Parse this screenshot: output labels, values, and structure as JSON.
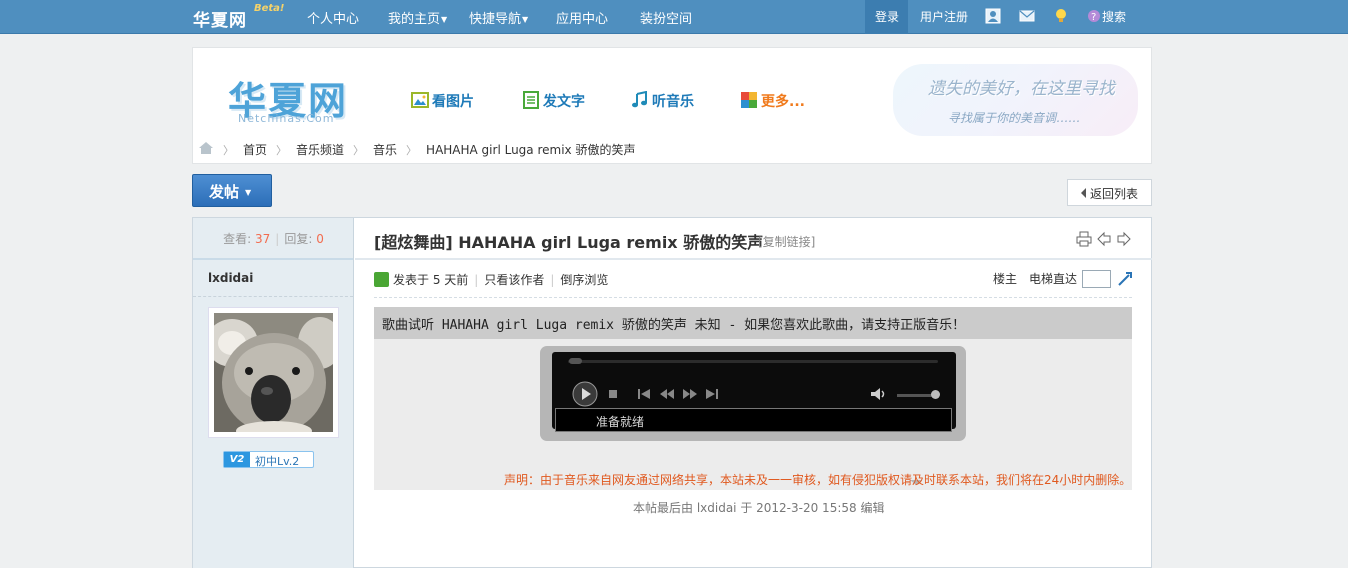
{
  "topbar": {
    "logo": "华夏网",
    "beta": "Beta!",
    "nav": [
      {
        "label": "个人中心",
        "caret": false
      },
      {
        "label": "我的主页",
        "caret": true
      },
      {
        "label": "快捷导航",
        "caret": true
      },
      {
        "label": "应用中心",
        "caret": false
      },
      {
        "label": "装扮空间",
        "caret": false
      }
    ],
    "login": "登录",
    "register": "用户注册",
    "search": "搜索",
    "icons": [
      "user-icon",
      "mail-icon",
      "bulb-icon",
      "search-icon"
    ]
  },
  "header": {
    "logo_text": "华夏网",
    "logo_sub": "Netchinas.Com",
    "quick_links": [
      {
        "label": "看图片",
        "icon": "image-icon"
      },
      {
        "label": "发文字",
        "icon": "document-icon"
      },
      {
        "label": "听音乐",
        "icon": "music-note-icon"
      },
      {
        "label": "更多...",
        "icon": "grid-icon"
      }
    ],
    "banner_line1": "遗失的美好，在这里寻找",
    "banner_line2": "寻找属于你的美音调……",
    "breadcrumb": [
      "首页",
      "音乐频道",
      "音乐",
      "HAHAHA girl Luga remix 骄傲的笑声"
    ]
  },
  "actions": {
    "post": "发帖",
    "back": "返回列表"
  },
  "sidebar": {
    "views_label": "查看:",
    "views": "37",
    "replies_label": "回复:",
    "replies": "0",
    "author": "lxdidai",
    "level_badge": "V2",
    "level": "初中Lv.2"
  },
  "thread": {
    "category": "[超炫舞曲]",
    "title": "HAHAHA girl Luga remix 骄傲的笑声",
    "copy_link": "[复制链接]",
    "posted": "发表于 5 天前",
    "only_author": "只看该作者",
    "reverse": "倒序浏览",
    "floor": "楼主",
    "elevator": "电梯直达"
  },
  "music": {
    "header": "歌曲试听 HAHAHA girl Luga remix 骄傲的笑声 未知 - 如果您喜欢此歌曲，请支持正版音乐！",
    "status": "准备就绪",
    "notice": "声明：由于音乐来自网友通过网络共享，本站未及一一审核，如有侵犯版权请及时联系本站，我们将在24小时内删除。"
  },
  "footer_note": "本帖最后由 lxdidai 于 2012-3-20 15:58 编辑",
  "colors": {
    "topbar": "#4f8fbf",
    "accent_blue": "#1e7ab8",
    "accent_orange": "#f07a1c",
    "notice": "#e0591f"
  }
}
